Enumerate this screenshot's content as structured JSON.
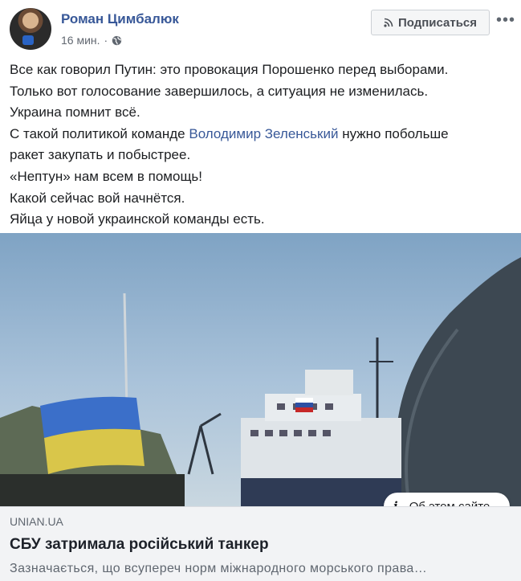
{
  "post": {
    "author": "Роман Цимбалюк",
    "time": "16 мин.",
    "privacy_icon": "globe-icon",
    "separator": "·",
    "follow_label": "Подписаться",
    "more_label": "•••",
    "text_lines": [
      "Все как говорил Путин: это провокация Порошенко перед выборами.",
      "Только вот голосование завершилось, а ситуация не изменилась.",
      "Украина помнит всё."
    ],
    "line4_before": "С такой политикой команде ",
    "mention": "Володимир Зеленський",
    "line4_after": " нужно побольше",
    "text_lines_after": [
      "ракет закупать и побыстрее.",
      "«Нептун» нам всем в помощь!",
      "Какой сейчас вой начнётся.",
      "Яйца у новой украинской команды есть."
    ]
  },
  "link": {
    "about_label": "Об этом сайте",
    "domain": "UNIAN.UA",
    "title": "СБУ затримала російський танкер",
    "description": "Зазначається, що всупереч норм міжнародного морського права…"
  },
  "colors": {
    "link_blue": "#385898",
    "text": "#1c1e21",
    "muted": "#606770",
    "card_bg": "#f2f3f5"
  }
}
